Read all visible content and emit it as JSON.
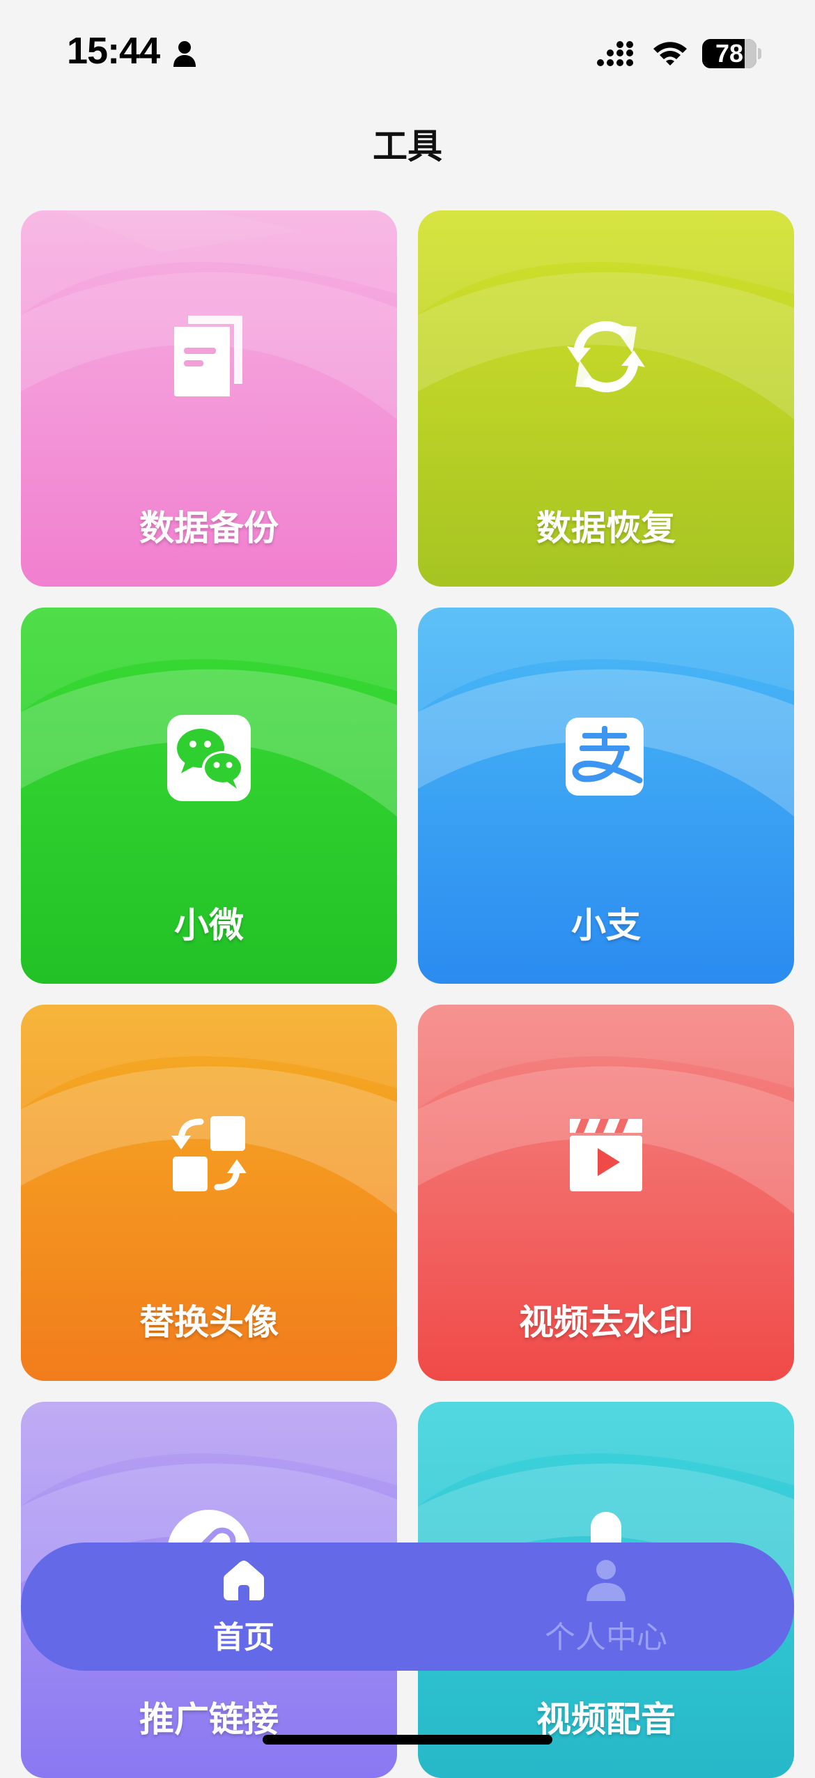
{
  "status_bar": {
    "time": "15:44",
    "battery": "78",
    "battery_level": 0.78
  },
  "header": {
    "title": "工具"
  },
  "tiles": [
    {
      "label": "数据备份",
      "icon": "document-copy-icon",
      "color_top": "#f6b1e2",
      "color_bottom": "#f17fcf"
    },
    {
      "label": "数据恢复",
      "icon": "refresh-icon",
      "color_top": "#d3e12c",
      "color_bottom": "#a6c422"
    },
    {
      "label": "小微",
      "icon": "wechat-icon",
      "color_top": "#3bdb35",
      "color_bottom": "#22c227"
    },
    {
      "label": "小支",
      "icon": "alipay-icon",
      "color_top": "#4bbaf6",
      "color_bottom": "#2b8bf0"
    },
    {
      "label": "替换头像",
      "icon": "swap-icon",
      "color_top": "#f5ad24",
      "color_bottom": "#f27c1c"
    },
    {
      "label": "视频去水印",
      "icon": "video-clapper-icon",
      "color_top": "#f48785",
      "color_bottom": "#f04a48"
    },
    {
      "label": "推广链接",
      "icon": "link-icon",
      "color_top": "#b9a3f3",
      "color_bottom": "#8a78f2"
    },
    {
      "label": "视频配音",
      "icon": "microphone-icon",
      "color_top": "#3ed4dd",
      "color_bottom": "#26b8c8"
    }
  ],
  "tab_bar": {
    "background": "#6469e8",
    "tabs": [
      {
        "label": "首页",
        "icon": "home-icon",
        "active": true
      },
      {
        "label": "个人中心",
        "icon": "person-icon",
        "active": false
      }
    ]
  }
}
